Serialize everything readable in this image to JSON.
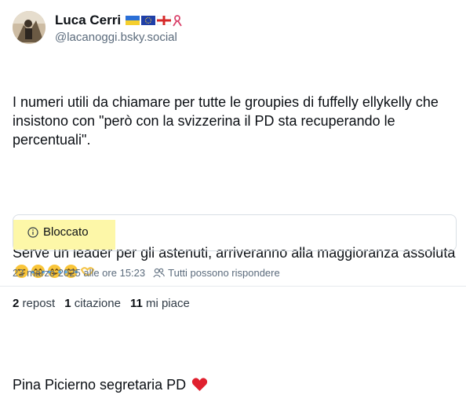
{
  "author": {
    "display_name": "Luca Cerri",
    "handle": "@lacanoggi.bsky.social",
    "badges": [
      "ukraine-flag-icon",
      "eu-flag-icon",
      "georgia-flag-icon",
      "awareness-ribbon-icon"
    ]
  },
  "post": {
    "paragraph1": "I numeri utili da chiamare per tutte le groupies di fuffelly ellykelly che insistono con \"però con la svizzerina il PD sta recuperando le percentuali\".",
    "paragraph2": "Serve un leader per gli astenuti, arriveranno alla maggioranza assoluta",
    "paragraph2_emojis": [
      "smirk-emoji-icon",
      "tears-of-joy-emoji-icon",
      "tears-of-joy-emoji-icon",
      "tears-of-joy-emoji-icon",
      "heart-hands-emoji-icon"
    ],
    "paragraph3": "Pina Picierno segretaria PD",
    "paragraph3_emoji": "red-heart-emoji-icon"
  },
  "embed": {
    "status_label": "Bloccato",
    "highlight_color": "#fdf7a8"
  },
  "meta": {
    "timestamp": "23 marzo 2025 alle ore 15:23",
    "reply_permission": "Tutti possono rispondere"
  },
  "stats": {
    "reposts_count": "2",
    "reposts_label": "repost",
    "quotes_count": "1",
    "quotes_label": "citazione",
    "likes_count": "11",
    "likes_label": "mi piace"
  }
}
